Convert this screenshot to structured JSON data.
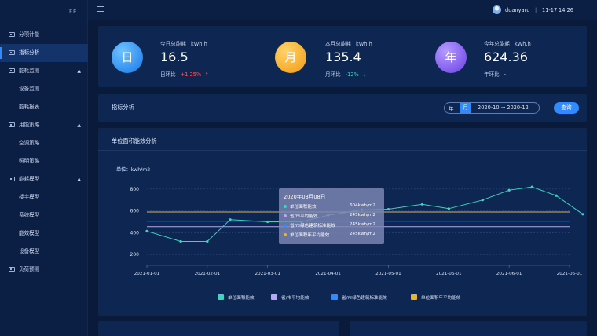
{
  "sidebar": {
    "logo_mark": "FE",
    "items": [
      {
        "label": "分项计量",
        "type": "group",
        "icon": "meter-icon"
      },
      {
        "label": "指标分析",
        "type": "group",
        "icon": "chart-icon",
        "active": true
      },
      {
        "label": "能耗监测",
        "type": "group",
        "icon": "monitor-icon",
        "expanded": true
      },
      {
        "label": "设备监测",
        "type": "sub"
      },
      {
        "label": "能耗报表",
        "type": "sub"
      },
      {
        "label": "用能策略",
        "type": "group",
        "icon": "strategy-icon",
        "expanded": true
      },
      {
        "label": "空调策略",
        "type": "sub"
      },
      {
        "label": "照明策略",
        "type": "sub"
      },
      {
        "label": "能耗模型",
        "type": "group",
        "icon": "model-icon",
        "expanded": true
      },
      {
        "label": "楼宇模型",
        "type": "sub"
      },
      {
        "label": "系统模型",
        "type": "sub"
      },
      {
        "label": "能效模型",
        "type": "sub"
      },
      {
        "label": "设备模型",
        "type": "sub"
      },
      {
        "label": "负荷预测",
        "type": "group",
        "icon": "forecast-icon"
      }
    ]
  },
  "header": {
    "user": "duanyaru",
    "separator": "|",
    "date": "11-17",
    "time": "14:26"
  },
  "kpis": [
    {
      "badge": "日",
      "title": "今日总能耗",
      "unit": "kWh.h",
      "value": "16.5",
      "compare_label": "日环比",
      "compare_value": "+1.25%",
      "trend": "up",
      "trend_arrow": "↑"
    },
    {
      "badge": "月",
      "title": "本月总能耗",
      "unit": "kWh.h",
      "value": "135.4",
      "compare_label": "月环比",
      "compare_value": "-12%",
      "trend": "down",
      "trend_arrow": "↓"
    },
    {
      "badge": "年",
      "title": "今年总能耗",
      "unit": "kWh.h",
      "value": "624.36",
      "compare_label": "年环比",
      "compare_value": "-",
      "trend": "flat",
      "trend_arrow": ""
    }
  ],
  "filter": {
    "title": "指标分析",
    "year_label": "年",
    "month_label": "月",
    "range": "2020-10 → 2020-12",
    "query_button": "查询"
  },
  "chart_panel": {
    "title": "单位面积能效分析",
    "ylabel": "单位：kwh/m2"
  },
  "tooltip": {
    "title": "2020年03月08日",
    "rows": [
      {
        "name": "单位面积能效",
        "value": "604kwh/m2",
        "color": "#3fd3c0"
      },
      {
        "name": "省/市平均能效",
        "value": "245kwh/m2",
        "color": "#b7a6f5"
      },
      {
        "name": "省/市绿色建筑标准能效",
        "value": "245kwh/m2",
        "color": "#2f8bff"
      },
      {
        "name": "单位面积年平均能效",
        "value": "245kwh/m2",
        "color": "#e3b341"
      }
    ]
  },
  "colors": {
    "accent": "#2f8bff",
    "series_main": "#3fd3c0",
    "series_avg": "#b7a6f5",
    "series_green": "#2f8bff",
    "series_year_avg": "#e3b341",
    "up": "#ff5a5a",
    "down": "#3fd3c0"
  },
  "chart_data": {
    "type": "line",
    "ylabel": "单位：kwh/m2",
    "ylim": [
      100,
      900
    ],
    "yticks": [
      200,
      400,
      600,
      800
    ],
    "grid": true,
    "legend_position": "bottom",
    "x_ticks": [
      "2021-01-01",
      "2021-02-01",
      "2021-03-01",
      "2021-04-01",
      "2021-05-01",
      "2021-06-01",
      "2021-06-01",
      "2021-06-01"
    ],
    "series": [
      {
        "name": "单位面积能效",
        "color": "#3fd3c0",
        "style": "line-markers",
        "points": [
          [
            0.0,
            415
          ],
          [
            0.56,
            320
          ],
          [
            1.0,
            320
          ],
          [
            1.38,
            520
          ],
          [
            2.0,
            500
          ],
          [
            2.56,
            500
          ],
          [
            3.0,
            560
          ],
          [
            3.56,
            610
          ],
          [
            4.0,
            615
          ],
          [
            4.56,
            660
          ],
          [
            5.0,
            620
          ],
          [
            5.56,
            700
          ],
          [
            6.0,
            790
          ],
          [
            6.38,
            820
          ],
          [
            6.78,
            740
          ],
          [
            7.22,
            570
          ]
        ]
      },
      {
        "name": "省/市平均能效",
        "color": "#b7a6f5",
        "style": "flat",
        "value": 455
      },
      {
        "name": "省/市绿色建筑标准能效",
        "color": "#2f8bff",
        "style": "flat",
        "value": 505
      },
      {
        "name": "单位面积年平均能效",
        "color": "#e3b341",
        "style": "flat",
        "value": 590
      }
    ]
  }
}
